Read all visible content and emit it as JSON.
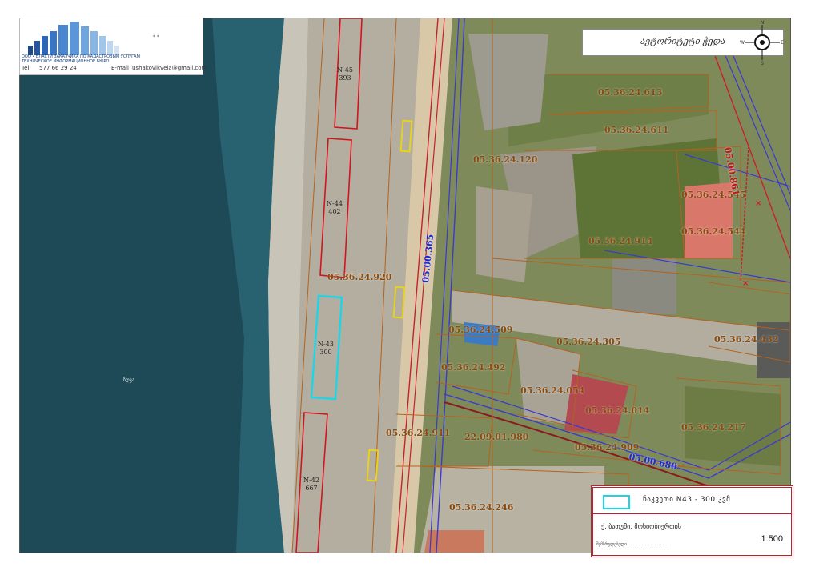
{
  "logo": {
    "company_line1": "ООО • ВЛАСТИ ЗАКАЗЧИКА ПО КАДАСТРОВЫМ УСЛУГАМ",
    "company_line2": "ТЕХНИЧЕСКОЕ ИНФОРМАЦИОННОЕ БЮРО",
    "small_mark": "* *",
    "phone_label": "Tel.",
    "phone": "577 66 29 24",
    "email_label": "E-mail",
    "email": "ushakovikvela@gmail.com"
  },
  "north_panel": {
    "script_text": "ავტორიტეტი ჭედა",
    "compass": {
      "n": "N",
      "s": "S",
      "e": "E",
      "w": "W"
    }
  },
  "parcels": [
    "05.36.24.613",
    "05.36.24.611",
    "05.36.24.120",
    "05.36.24.545",
    "05.36.24.544",
    "05.36.24.914",
    "05.36.24.920",
    "05.36.24.509",
    "05.36.24.305",
    "05.36.24.432",
    "05.36.24.492",
    "05.36.24.054",
    "05.36.24.014",
    "05.36.24.217",
    "05.36.24.911",
    "22.09.01.980",
    "05.36.24.909",
    "05.36.24.246"
  ],
  "roads": [
    "05.00.365",
    "05.00.680",
    "05.00.861"
  ],
  "plots": [
    {
      "id": "N-45",
      "area": "393"
    },
    {
      "id": "N-44",
      "area": "402"
    },
    {
      "id": "N-43",
      "area": "300"
    },
    {
      "id": "N-42",
      "area": "667"
    }
  ],
  "sea_label": "ზღვა",
  "legend": {
    "title": "ნაკვეთი N43 - 300 კვმ",
    "subtitle": "ქ. ბათუმი, მოხიობიერთის",
    "footer": "შემსრულებელი ................................",
    "scale": "1:500",
    "swatch_color": "#19d6e8"
  }
}
